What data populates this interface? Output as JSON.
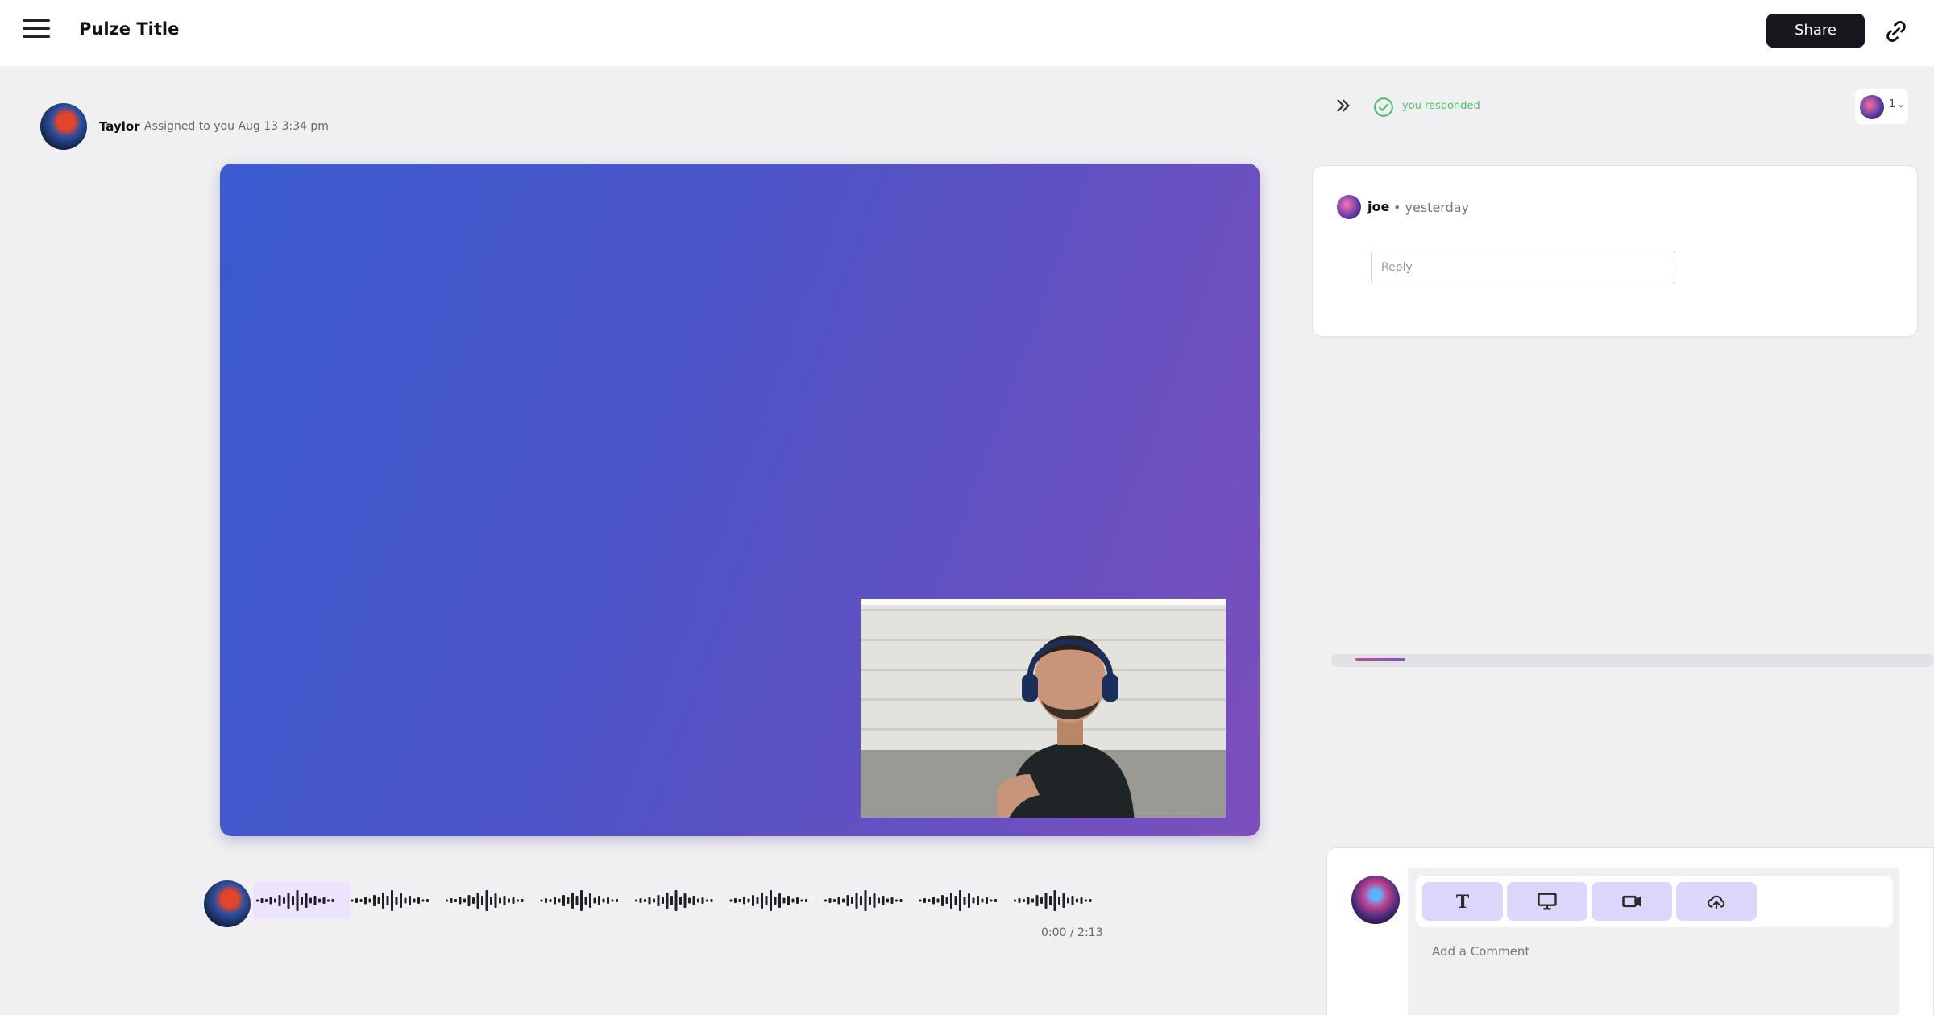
{
  "header": {
    "title": "Pulze Title",
    "share_label": "Share"
  },
  "post": {
    "author": "Taylor",
    "meta": "Assigned to you Aug 13 3:34 pm"
  },
  "audio": {
    "time": "0:00 / 2:13"
  },
  "panel": {
    "status_text": "you responded",
    "viewer_count": "1",
    "status_color": "#4ac36b"
  },
  "comment": {
    "author": "joe",
    "time": "• yesterday",
    "reply_placeholder": "Reply"
  },
  "composer": {
    "placeholder": "Add a Comment",
    "tools": [
      "text-icon",
      "screen-icon",
      "video-camera-icon",
      "upload-cloud-icon"
    ]
  },
  "colors": {
    "accent": "#ddd6fb",
    "video_gradient_start": "#3b5bd0",
    "video_gradient_end": "#7c4fbb",
    "dark_button": "#15171c"
  }
}
